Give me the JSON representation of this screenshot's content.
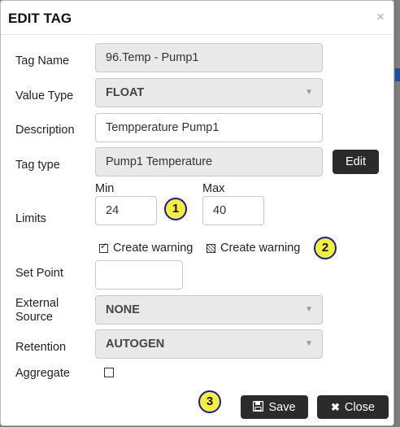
{
  "dialog": {
    "title": "EDIT TAG",
    "close_glyph": "×"
  },
  "fields": {
    "tag_name": {
      "label": "Tag Name",
      "value": "96.Temp - Pump1"
    },
    "value_type": {
      "label": "Value Type",
      "value": "FLOAT"
    },
    "description": {
      "label": "Description",
      "value": "Tempperature Pump1"
    },
    "tag_type": {
      "label": "Tag type",
      "value": "Pump1 Temperature",
      "edit_label": "Edit"
    },
    "limits": {
      "label": "Limits",
      "min_label": "Min",
      "min_value": "24",
      "max_label": "Max",
      "max_value": "40",
      "warn_min_label": "Create warning",
      "warn_min_checked": true,
      "warn_max_label": "Create warning",
      "warn_max_checked": "indeterminate"
    },
    "set_point": {
      "label": "Set Point",
      "value": ""
    },
    "external_source": {
      "label_line1": "External",
      "label_line2": "Source",
      "value": "NONE"
    },
    "retention": {
      "label": "Retention",
      "value": "AUTOGEN"
    },
    "aggregate": {
      "label": "Aggregate",
      "checked": false
    }
  },
  "callouts": {
    "one": "1",
    "two": "2",
    "three": "3"
  },
  "footer": {
    "save_label": "Save",
    "save_icon": "floppy-disk-icon",
    "close_label": "Close",
    "close_icon": "x-icon"
  },
  "colors": {
    "dark_button": "#2b2b2b",
    "callout_fill": "#f3ef3a",
    "callout_border": "#1a1aa8"
  }
}
